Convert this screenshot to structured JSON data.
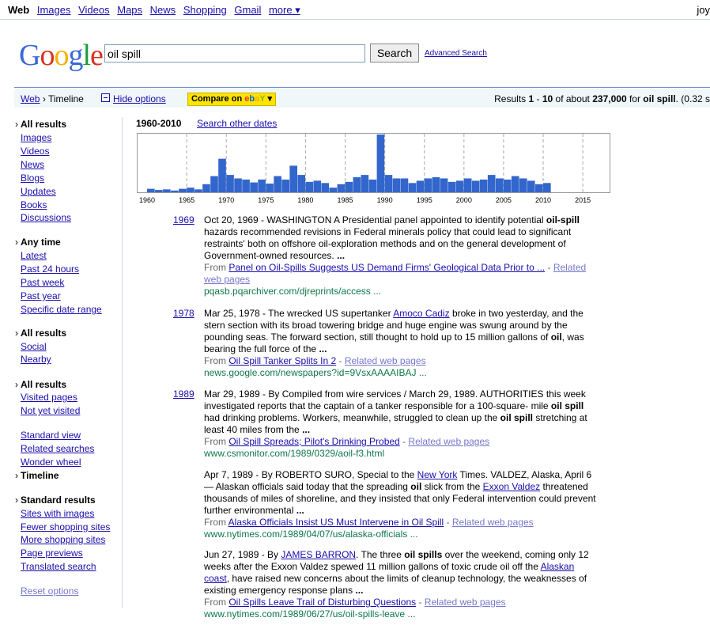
{
  "topnav": {
    "items": [
      "Web",
      "Images",
      "Videos",
      "Maps",
      "News",
      "Shopping",
      "Gmail",
      "more ▾"
    ],
    "user": "joy"
  },
  "logo": "Google",
  "search": {
    "query": "oil spill",
    "button": "Search",
    "advanced": "Advanced Search"
  },
  "optbar": {
    "crumb_web": "Web",
    "crumb_sep": "›",
    "crumb_cur": "Timeline",
    "hide": "Hide options",
    "ebay_prefix": "Compare on",
    "stats_pre": "Results ",
    "stats_a": "1",
    "stats_dash": " - ",
    "stats_b": "10",
    "stats_mid": " of about ",
    "stats_total": "237,000",
    "stats_for": " for ",
    "stats_query": "oil spill",
    "stats_time": ". (0.32 s"
  },
  "sidebar": {
    "all_results_1": "All results",
    "types": [
      "Images",
      "Videos",
      "News",
      "Blogs",
      "Updates",
      "Books",
      "Discussions"
    ],
    "any_time": "Any time",
    "times": [
      "Latest",
      "Past 24 hours",
      "Past week",
      "Past year",
      "Specific date range"
    ],
    "all_results_2": "All results",
    "social": [
      "Social",
      "Nearby"
    ],
    "all_results_3": "All results",
    "visited": [
      "Visited pages",
      "Not yet visited"
    ],
    "views": [
      "Standard view",
      "Related searches",
      "Wonder wheel"
    ],
    "timeline": "Timeline",
    "standard_results": "Standard results",
    "shopping": [
      "Sites with images",
      "Fewer shopping sites",
      "More shopping sites",
      "Page previews",
      "Translated search"
    ],
    "reset": "Reset options"
  },
  "timeline": {
    "range": "1960-2010",
    "other": "Search other dates"
  },
  "chart_data": {
    "type": "bar",
    "bar_color": "#3366cc",
    "x_ticks": [
      "1960",
      "1965",
      "1970",
      "1975",
      "1980",
      "1985",
      "1990",
      "1995",
      "2000",
      "2005",
      "2010",
      "2015"
    ],
    "years": [
      1960,
      1961,
      1962,
      1963,
      1964,
      1965,
      1966,
      1967,
      1968,
      1969,
      1970,
      1971,
      1972,
      1973,
      1974,
      1975,
      1976,
      1977,
      1978,
      1979,
      1980,
      1981,
      1982,
      1983,
      1984,
      1985,
      1986,
      1987,
      1988,
      1989,
      1990,
      1991,
      1992,
      1993,
      1994,
      1995,
      1996,
      1997,
      1998,
      1999,
      2000,
      2001,
      2002,
      2003,
      2004,
      2005,
      2006,
      2007,
      2008,
      2009,
      2010
    ],
    "values": [
      6,
      4,
      5,
      3,
      6,
      8,
      5,
      14,
      28,
      58,
      30,
      24,
      22,
      17,
      22,
      15,
      28,
      22,
      46,
      30,
      18,
      20,
      16,
      8,
      14,
      18,
      26,
      30,
      22,
      100,
      30,
      24,
      24,
      16,
      20,
      24,
      26,
      24,
      18,
      20,
      24,
      20,
      22,
      30,
      24,
      22,
      28,
      24,
      20,
      14,
      16
    ]
  },
  "results": [
    {
      "year": "1969",
      "text_parts": [
        {
          "t": "Oct 20, 1969 - WASHINGTON A Presidential panel appointed to identify potential "
        },
        {
          "t": "oil-spill",
          "b": true
        },
        {
          "t": " hazards recommended revisions in Federal minerals policy that could lead to significant restraints' both on offshore oil-exploration methods and on the general development of Government-owned resources. "
        },
        {
          "t": "...",
          "b": true
        }
      ],
      "from": "From ",
      "source_title": "Panel on Oil-Spills Suggests US Demand Firms' Geological Data Prior to ...",
      "related": "Related web pages",
      "url": "pqasb.pqarchiver.com/djreprints/access ..."
    },
    {
      "year": "1978",
      "text_parts": [
        {
          "t": "Mar 25, 1978 - The wrecked US supertanker "
        },
        {
          "t": "Amoco Cadiz",
          "l": true
        },
        {
          "t": " broke in two yesterday, and the stern section with its broad towering bridge and huge engine was swung around by the pounding seas. The forward section, still thought to hold up to 15 million gallons of "
        },
        {
          "t": "oil",
          "b": true
        },
        {
          "t": ", was bearing the full force of the "
        },
        {
          "t": "...",
          "b": true
        }
      ],
      "from": "From ",
      "source_title": "Oil Spill Tanker Splits In 2",
      "related": "Related web pages",
      "url": "news.google.com/newspapers?id=9VsxAAAAIBAJ ..."
    },
    {
      "year": "1989",
      "text_parts": [
        {
          "t": "Mar 29, 1989 - By Compiled from wire services / March 29, 1989. AUTHORITIES this week investigated reports that the captain of a tanker responsible for a 100-square- mile "
        },
        {
          "t": "oil spill",
          "b": true
        },
        {
          "t": " had drinking problems. Workers, meanwhile, struggled to clean up the "
        },
        {
          "t": "oil spill",
          "b": true
        },
        {
          "t": " stretching at least 40 miles from the "
        },
        {
          "t": "...",
          "b": true
        }
      ],
      "from": "From ",
      "source_title": "Oil Spill Spreads; Pilot's Drinking Probed",
      "related": "Related web pages",
      "url": "www.csmonitor.com/1989/0329/aoil-f3.html"
    },
    {
      "year": "",
      "text_parts": [
        {
          "t": "Apr 7, 1989 - By ROBERTO SURO, Special to the "
        },
        {
          "t": "New York",
          "l": true
        },
        {
          "t": " Times. VALDEZ, Alaska, April 6— Alaskan officials said today that the spreading "
        },
        {
          "t": "oil",
          "b": true
        },
        {
          "t": " slick from the "
        },
        {
          "t": "Exxon Valdez",
          "l": true
        },
        {
          "t": " threatened thousands of miles of shoreline, and they insisted that only Federal intervention could prevent further environmental "
        },
        {
          "t": "...",
          "b": true
        }
      ],
      "from": "From ",
      "source_title": "Alaska Officials Insist US Must Intervene in Oil Spill",
      "related": "Related web pages",
      "url": "www.nytimes.com/1989/04/07/us/alaska-officials ..."
    },
    {
      "year": "",
      "text_parts": [
        {
          "t": "Jun 27, 1989 - By "
        },
        {
          "t": "JAMES BARRON",
          "l": true
        },
        {
          "t": ". The three "
        },
        {
          "t": "oil spills",
          "b": true
        },
        {
          "t": " over the weekend, coming only 12 weeks after the Exxon Valdez spewed 11 million gallons of toxic crude oil off the "
        },
        {
          "t": "Alaskan coast",
          "l": true
        },
        {
          "t": ", have raised new concerns about the limits of cleanup technology, the weaknesses of existing emergency response plans "
        },
        {
          "t": "...",
          "b": true
        }
      ],
      "from": "From ",
      "source_title": "Oil Spills Leave Trail of Disturbing Questions",
      "related": "Related web pages",
      "url": "www.nytimes.com/1989/06/27/us/oil-spills-leave ..."
    }
  ]
}
